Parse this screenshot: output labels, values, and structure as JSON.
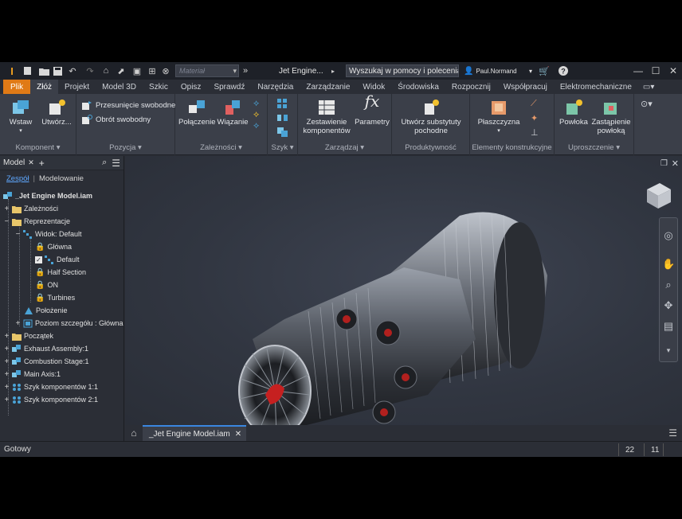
{
  "titlebar": {
    "material_placeholder": "Materiał",
    "doc_title": "Jet Engine...",
    "help_search": "Wyszukaj w pomocy i poleceniach",
    "user_name": "Paul.Normand"
  },
  "ribbon_tabs": [
    "Plik",
    "Złóż",
    "Projekt",
    "Model 3D",
    "Szkic",
    "Opisz",
    "Sprawdź",
    "Narzędzia",
    "Zarządzanie",
    "Widok",
    "Środowiska",
    "Rozpocznij",
    "Współpracuj",
    "Elektromechaniczne"
  ],
  "ribbon": {
    "komponent": {
      "label": "Komponent",
      "wstaw": "Wstaw",
      "utworz": "Utwórz..."
    },
    "pozycja": {
      "label": "Pozycja",
      "przesuniecie": "Przesunięcie swobodne",
      "obrot": "Obrót swobodny"
    },
    "zaleznosci": {
      "label": "Zależności",
      "polaczenie": "Połączenie",
      "wiazanie": "Wiązanie"
    },
    "szyk": {
      "label": "Szyk"
    },
    "zarzadzaj": {
      "label": "Zarządzaj",
      "zestawienie_1": "Zestawienie",
      "zestawienie_2": "komponentów",
      "parametry": "Parametry"
    },
    "produktywnosc": {
      "label": "Produktywność",
      "utworz_1": "Utwórz substytuty",
      "utworz_2": "pochodne"
    },
    "elementy": {
      "label": "Elementy konstrukcyjne",
      "plaszczyzna": "Płaszczyzna"
    },
    "uproszczenie": {
      "label": "Uproszczenie",
      "powloka": "Powłoka",
      "zastapienie_1": "Zastąpienie",
      "zastapienie_2": "powłoką"
    }
  },
  "browser": {
    "title": "Model",
    "tab_zespol": "Zespół",
    "tab_modelowanie": "Modelowanie",
    "tree": {
      "root": "_Jet Engine Model.iam",
      "zaleznosci": "Zależności",
      "reprezentacje": "Reprezentacje",
      "widok": "Widok: Default",
      "glowna": "Główna",
      "default": "Default",
      "half_section": "Half Section",
      "on": "ON",
      "turbines": "Turbines",
      "polozenie": "Położenie",
      "poziom": "Poziom szczegółu : Główna",
      "poczatek": "Początek",
      "exhaust": "Exhaust Assembly:1",
      "combustion": "Combustion Stage:1",
      "main_axis": "Main Axis:1",
      "szyk1": "Szyk komponentów 1:1",
      "szyk2": "Szyk komponentów 2:1"
    }
  },
  "doc_tab": "_Jet Engine Model.iam",
  "status": {
    "text": "Gotowy",
    "count1": "22",
    "count2": "11"
  },
  "colors": {
    "accent_orange": "#e07a16",
    "selection_blue": "#3a86e0",
    "bg_dark": "#2b2e36"
  }
}
